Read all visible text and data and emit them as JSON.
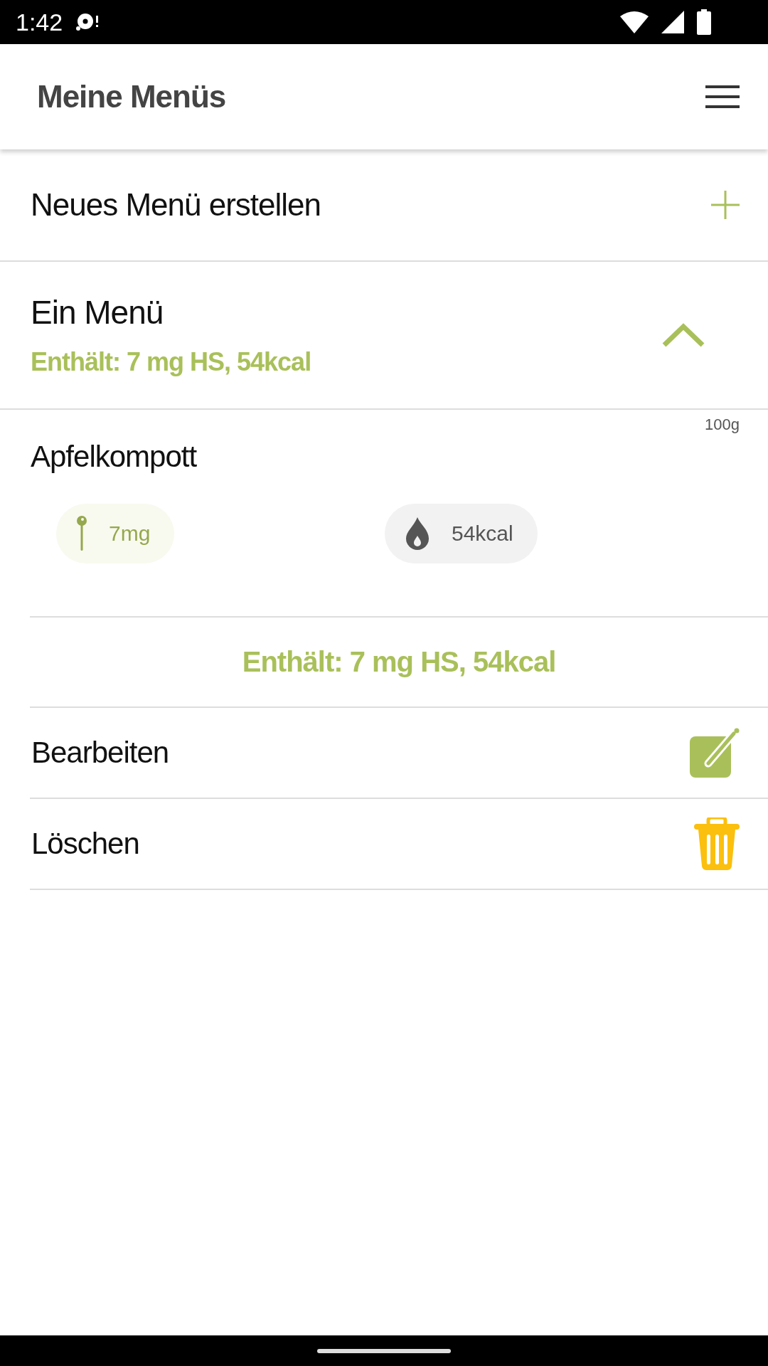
{
  "status_bar": {
    "time": "1:42"
  },
  "app_bar": {
    "title": "Meine Menüs"
  },
  "create_row": {
    "label": "Neues Menü erstellen"
  },
  "menus": [
    {
      "name": "Ein Menü",
      "summary": "Enthält: 7 mg HS, 54kcal",
      "expanded": true,
      "items": [
        {
          "name": "Apfelkompott",
          "amount": "100g",
          "pills": [
            {
              "kind": "acid",
              "value": "7mg"
            },
            {
              "kind": "energy",
              "value": "54kcal"
            }
          ]
        }
      ],
      "total": "Enthält: 7 mg HS, 54kcal",
      "actions": [
        {
          "kind": "edit",
          "label": "Bearbeiten"
        },
        {
          "kind": "delete",
          "label": "Löschen"
        }
      ]
    }
  ]
}
